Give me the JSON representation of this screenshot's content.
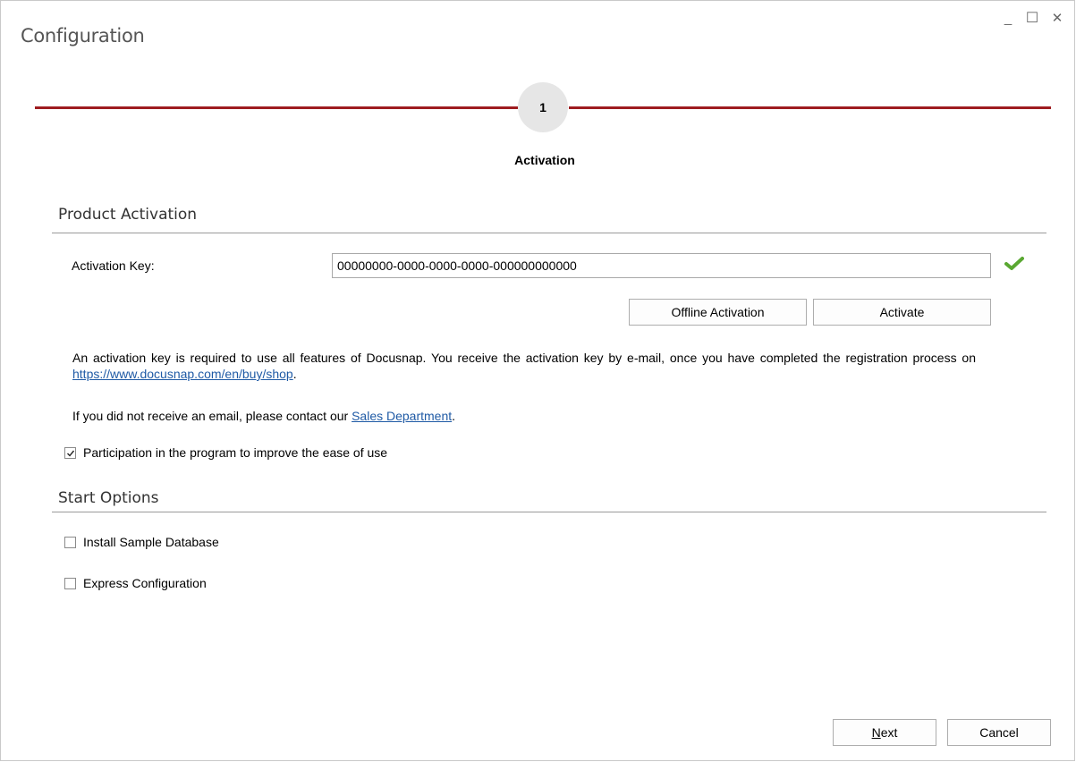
{
  "window": {
    "title": "Configuration",
    "minimize_glyph": "_",
    "maximize_glyph": "☐",
    "close_glyph": "✕"
  },
  "stepper": {
    "current_step": "1",
    "step_label": "Activation",
    "accent_color": "#9e1c20"
  },
  "product_activation": {
    "heading": "Product Activation",
    "key_label": "Activation Key:",
    "key_value": "00000000-0000-0000-0000-000000000000",
    "key_valid_icon": "checkmark-icon",
    "offline_button": "Offline Activation",
    "activate_button": "Activate",
    "info_text_1": "An activation key is required to use all features of Docusnap. You receive the activation key by e-mail, once you have completed the registration process on ",
    "shop_link": "https://www.docusnap.com/en/buy/shop",
    "info_text_1_end": ".",
    "info_text_2": "If you did not receive an email, please contact our ",
    "sales_link": "Sales Department",
    "info_text_2_end": ".",
    "participation_label": "Participation in the program to improve the ease of use",
    "participation_checked": true
  },
  "start_options": {
    "heading": "Start Options",
    "install_sample_label": "Install Sample Database",
    "install_sample_checked": false,
    "express_config_label": "Express Configuration",
    "express_config_checked": false
  },
  "footer": {
    "next_button": "Next",
    "cancel_button": "Cancel"
  }
}
